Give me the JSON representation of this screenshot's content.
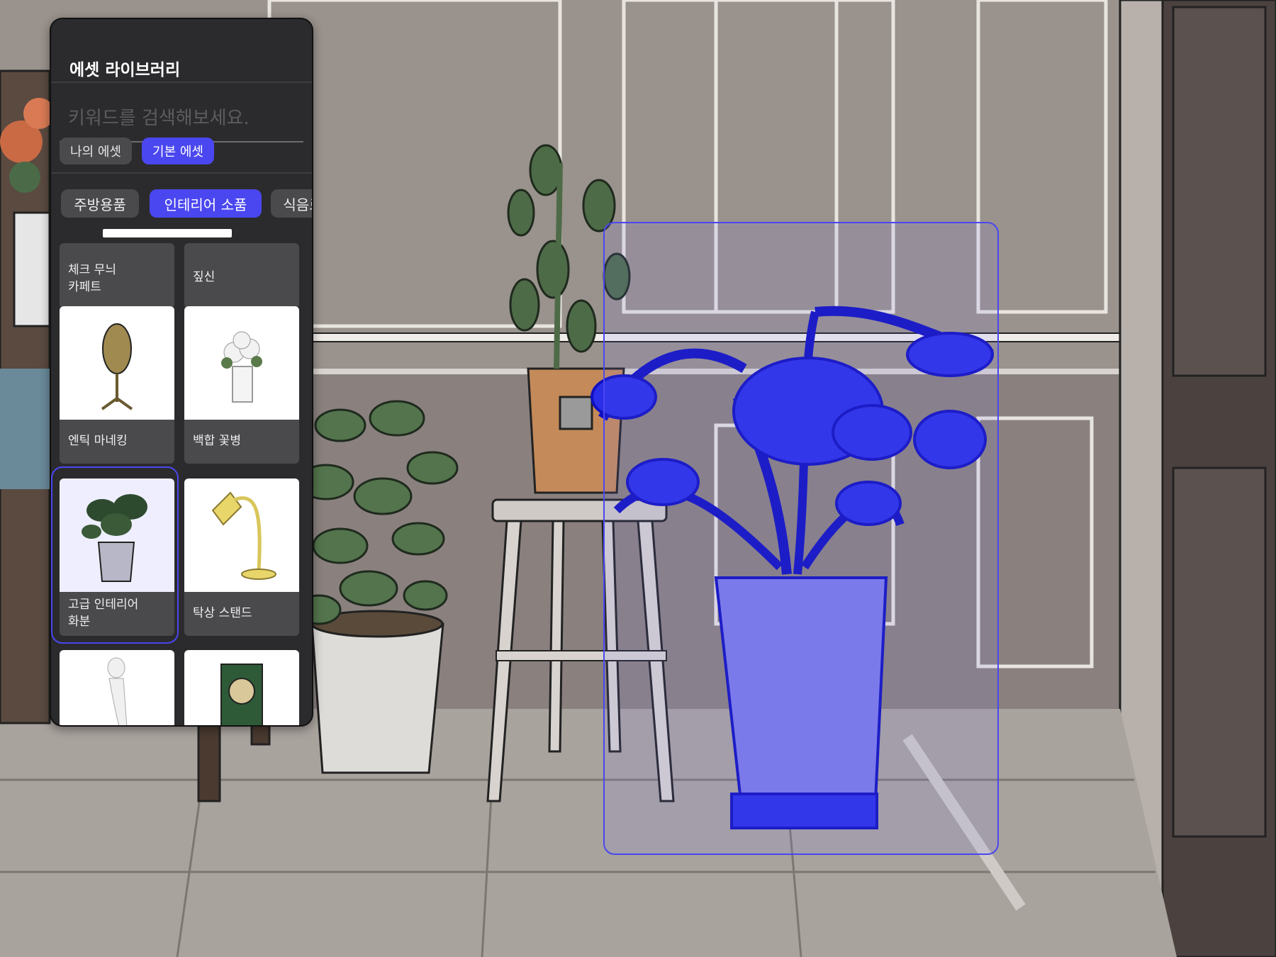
{
  "panel": {
    "title": "에셋 라이브러리",
    "search_placeholder": "키워드를 검색해보세요.",
    "source_tabs": [
      "나의 에셋",
      "기본 에셋"
    ],
    "categories": [
      "주방용품",
      "인테리어 소품",
      "식음료"
    ],
    "assets": [
      {
        "label": "체크 무늬\n카페트"
      },
      {
        "label": "짚신"
      },
      {
        "label": "엔틱 마네킹"
      },
      {
        "label": "백합 꽃병"
      },
      {
        "label": "고급 인테리어\n화분",
        "selected": true
      },
      {
        "label": "탁상 스탠드"
      },
      {
        "label": ""
      },
      {
        "label": ""
      }
    ]
  },
  "colors": {
    "accent": "#4a47f0",
    "panel_bg": "#2b2b2d"
  }
}
